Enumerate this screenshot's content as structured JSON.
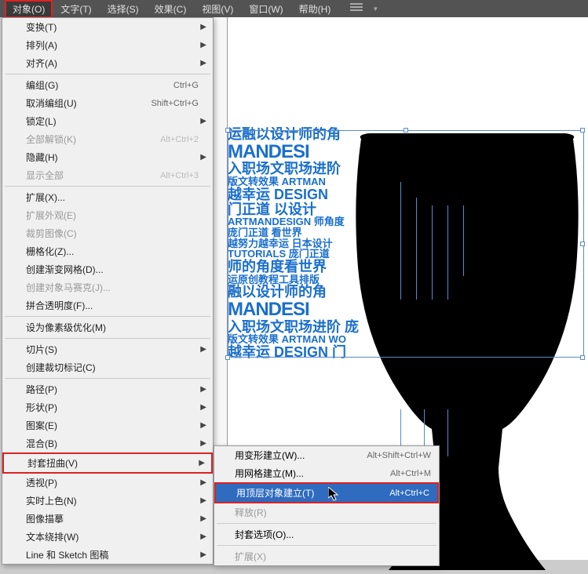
{
  "menubar": {
    "items": [
      "对象(O)",
      "文字(T)",
      "选择(S)",
      "效果(C)",
      "视图(V)",
      "窗口(W)",
      "帮助(H)"
    ],
    "active_index": 0
  },
  "dropdown": [
    {
      "label": "变换(T)",
      "arrow": true
    },
    {
      "label": "排列(A)",
      "arrow": true
    },
    {
      "label": "对齐(A)",
      "arrow": true
    },
    {
      "sep": true
    },
    {
      "label": "编组(G)",
      "shortcut": "Ctrl+G"
    },
    {
      "label": "取消编组(U)",
      "shortcut": "Shift+Ctrl+G"
    },
    {
      "label": "锁定(L)",
      "arrow": true
    },
    {
      "label": "全部解锁(K)",
      "shortcut": "Alt+Ctrl+2",
      "disabled": true
    },
    {
      "label": "隐藏(H)",
      "arrow": true
    },
    {
      "label": "显示全部",
      "shortcut": "Alt+Ctrl+3",
      "disabled": true
    },
    {
      "sep": true
    },
    {
      "label": "扩展(X)..."
    },
    {
      "label": "扩展外观(E)",
      "disabled": true
    },
    {
      "label": "裁剪图像(C)",
      "disabled": true
    },
    {
      "label": "栅格化(Z)..."
    },
    {
      "label": "创建渐变网格(D)..."
    },
    {
      "label": "创建对象马赛克(J)...",
      "disabled": true
    },
    {
      "label": "拼合透明度(F)..."
    },
    {
      "sep": true
    },
    {
      "label": "设为像素级优化(M)"
    },
    {
      "sep": true
    },
    {
      "label": "切片(S)",
      "arrow": true
    },
    {
      "label": "创建裁切标记(C)"
    },
    {
      "sep": true
    },
    {
      "label": "路径(P)",
      "arrow": true
    },
    {
      "label": "形状(P)",
      "arrow": true
    },
    {
      "label": "图案(E)",
      "arrow": true
    },
    {
      "label": "混合(B)",
      "arrow": true
    },
    {
      "label": "封套扭曲(V)",
      "arrow": true,
      "highlighted": true
    },
    {
      "label": "透视(P)",
      "arrow": true
    },
    {
      "label": "实时上色(N)",
      "arrow": true
    },
    {
      "label": "图像描摹",
      "arrow": true
    },
    {
      "label": "文本绕排(W)",
      "arrow": true
    },
    {
      "label": "Line 和 Sketch 图稿",
      "arrow": true
    }
  ],
  "submenu": [
    {
      "label": "用变形建立(W)...",
      "shortcut": "Alt+Shift+Ctrl+W"
    },
    {
      "label": "用网格建立(M)...",
      "shortcut": "Alt+Ctrl+M"
    },
    {
      "label": "用顶层对象建立(T)",
      "shortcut": "Alt+Ctrl+C",
      "highlighted": true
    },
    {
      "label": "释放(R)",
      "disabled": true
    },
    {
      "sep": true
    },
    {
      "label": "封套选项(O)..."
    },
    {
      "sep": true
    },
    {
      "label": "扩展(X)",
      "disabled": true
    }
  ],
  "artwork": {
    "lines": [
      "运融以设计师的角",
      "MANDESI",
      "入职场文职场进阶",
      "版文转效果 ARTMAN",
      "越幸运 DESIGN",
      "门正道 以设计",
      "ARTMANDESIGN 师角度",
      "庞门正道 看世界",
      "越努力越幸运 日本设计",
      "TUTORIALS 庞门正道",
      "师的角度看世界",
      "运原创教程工具排版",
      "融以设计师的角",
      "MANDESI",
      "入职场文职场进阶 庞",
      "版文转效果 ARTMAN WO",
      "越幸运 DESIGN 门"
    ]
  }
}
